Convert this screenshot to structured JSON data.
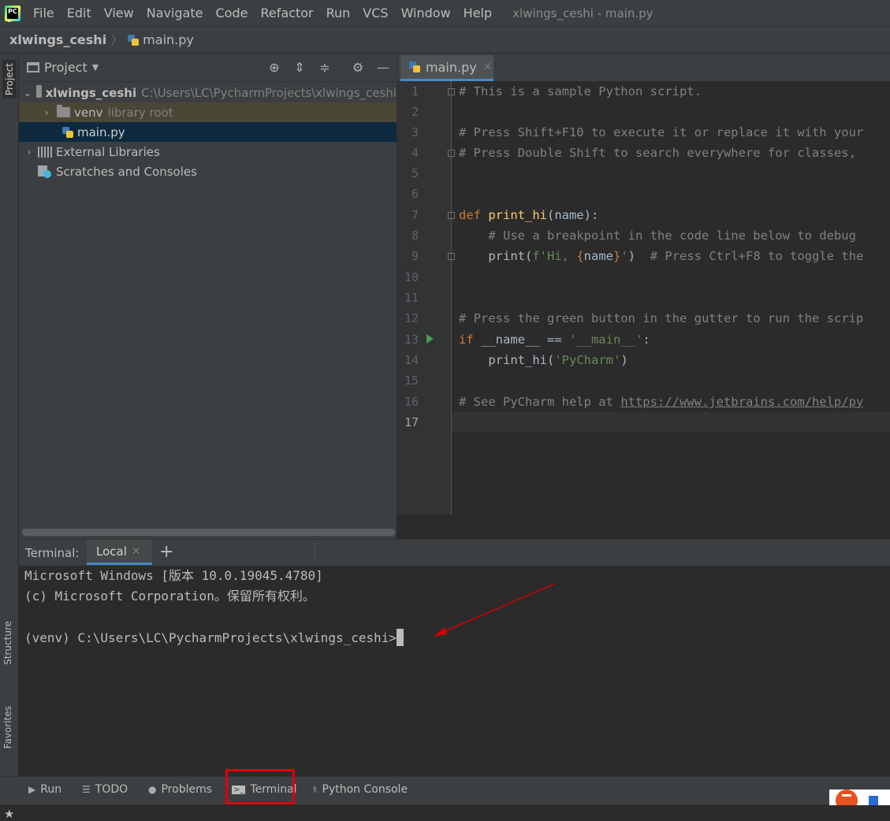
{
  "menu": {
    "items": [
      "File",
      "Edit",
      "View",
      "Navigate",
      "Code",
      "Refactor",
      "Run",
      "VCS",
      "Window",
      "Help"
    ],
    "window_title": "xlwings_ceshi - main.py"
  },
  "breadcrumb": {
    "project": "xlwings_ceshi",
    "file": "main.py"
  },
  "left_strip": {
    "project": "Project",
    "structure": "Structure",
    "favorites": "Favorites"
  },
  "project_pane": {
    "title": "Project",
    "tree": {
      "root_name": "xlwings_ceshi",
      "root_path": "C:\\Users\\LC\\PycharmProjects\\xlwings_ceshi",
      "venv_name": "venv",
      "venv_hint": "library root",
      "main_file": "main.py",
      "external_libraries": "External Libraries",
      "scratches": "Scratches and Consoles"
    }
  },
  "editor": {
    "tab_label": "main.py",
    "line_numbers": [
      "1",
      "2",
      "3",
      "4",
      "5",
      "6",
      "7",
      "8",
      "9",
      "10",
      "11",
      "12",
      "13",
      "14",
      "15",
      "16",
      "17"
    ],
    "code": {
      "l1": "# This is a sample Python script.",
      "l3": "# Press Shift+F10 to execute it or replace it with your",
      "l4": "# Press Double Shift to search everywhere for classes,",
      "l7_kw": "def ",
      "l7_fn": "print_hi",
      "l7_rest": "(name):",
      "l8": "    # Use a breakpoint in the code line below to debug",
      "l9_a": "    print(",
      "l9_str1": "f'Hi, ",
      "l9_brace1": "{",
      "l9_name": "name",
      "l9_brace2": "}",
      "l9_str2": "'",
      "l9_b": ")  ",
      "l9_comment": "# Press Ctrl+F8 to toggle the",
      "l12": "# Press the green button in the gutter to run the scrip",
      "l13_kw": "if ",
      "l13_mid": "__name__ == ",
      "l13_str": "'__main__'",
      "l13_end": ":",
      "l14_a": "    print_hi(",
      "l14_str": "'PyCharm'",
      "l14_b": ")",
      "l16_comment": "# See PyCharm help at ",
      "l16_link": "https://www.jetbrains.com/help/py"
    }
  },
  "terminal": {
    "label": "Terminal:",
    "tab": "Local",
    "lines": [
      "Microsoft Windows [版本 10.0.19045.4780]",
      "(c) Microsoft Corporation。保留所有权利。",
      "(venv) C:\\Users\\LC\\PycharmProjects\\xlwings_ceshi>"
    ]
  },
  "bottom_bar": {
    "run": "Run",
    "todo": "TODO",
    "problems": "Problems",
    "terminal": "Terminal",
    "python_console": "Python Console"
  },
  "colors": {
    "accent": "#4a88c7",
    "highlight_box": "#e0000a",
    "annotation_arrow": "#d00000"
  }
}
